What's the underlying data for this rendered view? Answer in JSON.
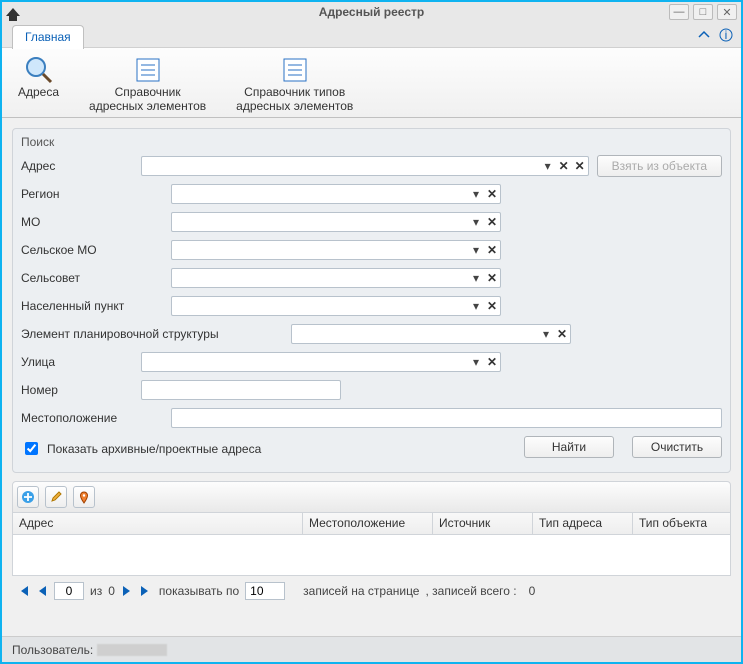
{
  "window": {
    "title": "Адресный реестр"
  },
  "ribbon": {
    "tab_main": "Главная",
    "btn_addresses": "Адреса",
    "btn_elements_l1": "Справочник",
    "btn_elements_l2": "адресных элементов",
    "btn_types_l1": "Справочник типов",
    "btn_types_l2": "адресных элементов"
  },
  "search": {
    "panel_title": "Поиск",
    "lbl_address": "Адрес",
    "lbl_region": "Регион",
    "lbl_mo": "МО",
    "lbl_selmo": "Сельское МО",
    "lbl_selsovet": "Сельсовет",
    "lbl_nas": "Населенный пункт",
    "lbl_eps": "Элемент планировочной структуры",
    "lbl_street": "Улица",
    "lbl_number": "Номер",
    "lbl_location": "Местоположение",
    "chk_archive": "Показать архивные/проектные адреса",
    "btn_take": "Взять из объекта",
    "btn_find": "Найти",
    "btn_clear": "Очистить"
  },
  "grid": {
    "col_address": "Адрес",
    "col_location": "Местоположение",
    "col_source": "Источник",
    "col_type": "Тип адреса",
    "col_objtype": "Тип объекта"
  },
  "pager": {
    "cur": "0",
    "of_txt": "из",
    "total_pages": "0",
    "show_by": "показывать по",
    "by_val": "10",
    "per_page": "записей на странице",
    "total_lbl": ", записей всего :",
    "total_rec": "0"
  },
  "status": {
    "user_lbl": "Пользователь:"
  }
}
